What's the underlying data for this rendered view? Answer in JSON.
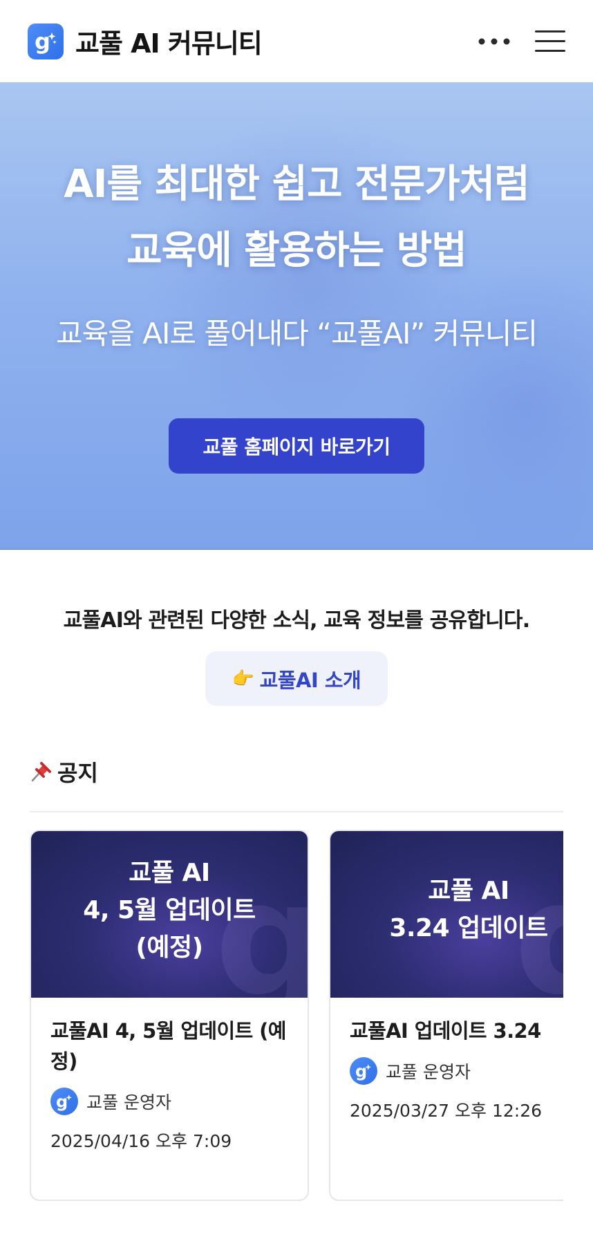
{
  "header": {
    "app_title": "교풀 AI 커뮤니티",
    "logo_icon": "g-sparkle-logo-icon",
    "more_icon": "more-horizontal-icon",
    "menu_icon": "hamburger-menu-icon"
  },
  "hero": {
    "title_line1": "AI를 최대한 쉽고 전문가처럼",
    "title_line2": "교육에 활용하는 방법",
    "subtitle": "교육을 AI로 풀어내다 “교풀AI” 커뮤니티",
    "button_label": "교풀 홈페이지 바로가기"
  },
  "intro": {
    "text": "교풀AI와 관련된 다양한 소식, 교육 정보를 공유합니다.",
    "button_label": "교풀AI 소개",
    "button_emoji": "👉"
  },
  "notice": {
    "section_title": "공지",
    "section_icon": "pushpin-icon",
    "cards": [
      {
        "thumb_line1": "교풀 AI",
        "thumb_line2": "4, 5월 업데이트",
        "thumb_line3": "(예정)",
        "title": "교풀AI 4, 5월 업데이트 (예정)",
        "author": "교풀 운영자",
        "date": "2025/04/16 오후 7:09"
      },
      {
        "thumb_line1": "교풀 AI",
        "thumb_line2": "3.24 업데이트",
        "title": "교풀AI 업데이트 3.24",
        "author": "교풀 운영자",
        "date": "2025/03/27 오후 12:26"
      }
    ]
  },
  "colors": {
    "brand_blue": "#3443cc",
    "logo_blue": "#3a7bf0",
    "hero_bg": "#90b2ee",
    "card_thumb_bg": "#2d2d72"
  }
}
